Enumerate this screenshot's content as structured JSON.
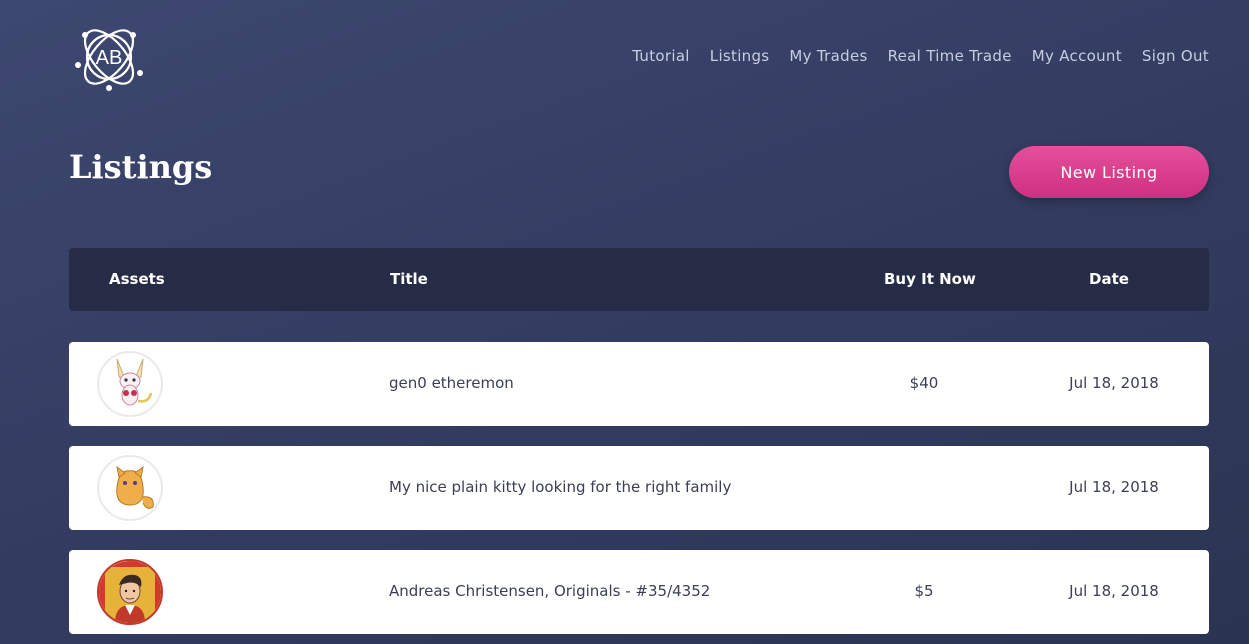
{
  "logo": {
    "text": "AB"
  },
  "nav": {
    "items": [
      "Tutorial",
      "Listings",
      "My Trades",
      "Real Time Trade",
      "My Account",
      "Sign Out"
    ]
  },
  "page": {
    "title": "Listings",
    "new_listing_label": "New Listing"
  },
  "table": {
    "headers": {
      "assets": "Assets",
      "title": "Title",
      "buy_it_now": "Buy It Now",
      "date": "Date"
    },
    "rows": [
      {
        "asset_icon": "etheremon-creature-icon",
        "title": "gen0 etheremon",
        "price": "$40",
        "date": "Jul 18, 2018"
      },
      {
        "asset_icon": "cryptokitty-icon",
        "title": "My nice plain kitty looking for the right family",
        "price": "",
        "date": "Jul 18, 2018"
      },
      {
        "asset_icon": "player-card-icon",
        "title": "Andreas Christensen, Originals - #35/4352",
        "price": "$5",
        "date": "Jul 18, 2018"
      }
    ]
  },
  "colors": {
    "background": "#343d62",
    "header_bar": "#262c45",
    "accent": "#d9408c",
    "row_bg": "#ffffff"
  }
}
